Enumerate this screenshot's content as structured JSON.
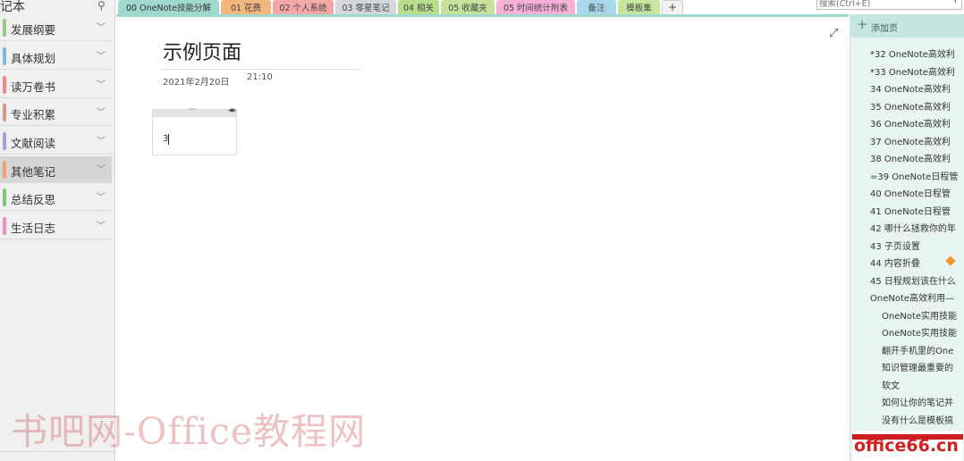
{
  "notebook": {
    "title": "记本",
    "sections": [
      {
        "label": "发展纲要",
        "color": "#95c97a"
      },
      {
        "label": "具体规划",
        "color": "#7fb9d9"
      },
      {
        "label": "读万卷书",
        "color": "#ef8a8a"
      },
      {
        "label": "专业积累",
        "color": "#d39c83"
      },
      {
        "label": "文献阅读",
        "color": "#a9a2d8"
      },
      {
        "label": "其他笔记",
        "color": "#f2a36a"
      },
      {
        "label": "总结反思",
        "color": "#7cc77a"
      },
      {
        "label": "生活日志",
        "color": "#ee8ec4"
      }
    ],
    "selected_section": "其他笔记"
  },
  "tabs": [
    {
      "label": "00 OneNote技能分解",
      "color": "#9fd8cc"
    },
    {
      "label": "01 花费",
      "color": "#f3b67d"
    },
    {
      "label": "02 个人系统",
      "color": "#f4a7a7"
    },
    {
      "label": "03 零星笔记",
      "color": "#d4d7dc"
    },
    {
      "label": "04 相关",
      "color": "#b8de8c"
    },
    {
      "label": "05 收藏夹",
      "color": "#c6e29a"
    },
    {
      "label": "05 时间统计附表",
      "color": "#f7b0d6"
    },
    {
      "label": "备注",
      "color": "#a8d8ea"
    },
    {
      "label": "模板集",
      "color": "#c9e6a1"
    },
    {
      "label": "+",
      "color": "#f2f2f2"
    }
  ],
  "search": {
    "placeholder": "搜索(Ctrl+E)"
  },
  "page": {
    "title": "示例页面",
    "date": "2021年2月20日",
    "time": "21:10",
    "note_text": "3"
  },
  "page_list": {
    "add_label": "添加页",
    "pages": [
      "*32 OneNote高效利",
      "*33 OneNote高效利",
      "34 OneNote高效利",
      "35 OneNote高效利",
      "36 OneNote高效利",
      "37 OneNote高效利",
      "38 OneNote高效利",
      "=39 OneNote日程管",
      "40 OneNote日程管",
      "41 OneNote日程管",
      "42 哪什么拯救你的年",
      "43 子页设置",
      "44 内容折叠",
      "45 日程规划该在什么",
      "OneNote高效利用—",
      "OneNote实用技能",
      "OneNote实用技能",
      "翻开手机里的One",
      "知识管理最重要的",
      "软文",
      "如何让你的笔记并",
      "没有什么是模板搞"
    ]
  },
  "watermarks": {
    "left": "书吧网-Office教程网",
    "right": "office66.cn"
  }
}
